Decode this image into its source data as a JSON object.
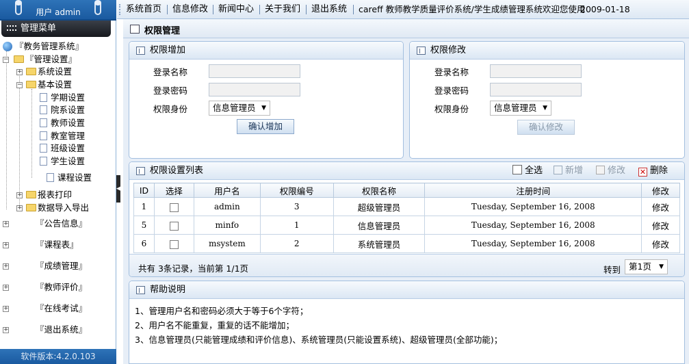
{
  "sidebar": {
    "user_label": "用户 admin",
    "menu_title": "管理菜单",
    "root": "『教务管理系统』",
    "tree": {
      "admin_setup": "『管理设置』",
      "system_setup": "系统设置",
      "basic_setup": "基本设置",
      "basic_children": [
        "学期设置",
        "院系设置",
        "教师设置",
        "教室管理",
        "班级设置",
        "学生设置"
      ],
      "course_setup": "课程设置",
      "report_print": "报表打印",
      "data_io": "数据导入导出"
    },
    "groups": [
      "『公告信息』",
      "『课程表』",
      "『成绩管理』",
      "『教师评价』",
      "『在线考试』",
      "『退出系统』"
    ],
    "version": "软件版本:4.2.0.103"
  },
  "topnav": {
    "items": [
      "系统首页",
      "信息修改",
      "新闻中心",
      "关于我们",
      "退出系统"
    ],
    "welcome": "careff 教师教学质量评价系统/学生成绩管理系统欢迎您使用",
    "date": "2009-01-18"
  },
  "page_title": "权限管理",
  "add_panel": {
    "title": "权限增加",
    "login_name_label": "登录名称",
    "login_pwd_label": "登录密码",
    "role_label": "权限身份",
    "role_value": "信息管理员",
    "submit": "确认增加"
  },
  "edit_panel": {
    "title": "权限修改",
    "login_name_label": "登录名称",
    "login_pwd_label": "登录密码",
    "role_label": "权限身份",
    "role_value": "信息管理员",
    "submit": "确认修改"
  },
  "list_panel": {
    "title": "权限设置列表",
    "select_all": "全选",
    "add": "新增",
    "edit": "修改",
    "delete": "删除",
    "columns": [
      "ID",
      "选择",
      "用户名",
      "权限编号",
      "权限名称",
      "注册时间",
      "修改"
    ],
    "rows": [
      {
        "id": "1",
        "username": "admin",
        "code": "3",
        "role": "超级管理员",
        "time": "Tuesday, September 16, 2008",
        "action": "修改"
      },
      {
        "id": "5",
        "username": "minfo",
        "code": "1",
        "role": "信息管理员",
        "time": "Tuesday, September 16, 2008",
        "action": "修改"
      },
      {
        "id": "6",
        "username": "msystem",
        "code": "2",
        "role": "系统管理员",
        "time": "Tuesday, September 16, 2008",
        "action": "修改"
      }
    ],
    "summary": "共有 3条记录，当前第 1/1页",
    "goto_label": "转到",
    "page_select": "第1页"
  },
  "help_panel": {
    "title": "帮助说明",
    "lines": [
      "1、管理用户名和密码必须大于等于6个字符；",
      "2、用户名不能重复，重复的话不能增加；",
      "3、信息管理员(只能管理成绩和评价信息)、系统管理员(只能设置系统)、超级管理员(全部功能)；"
    ]
  },
  "colors": {
    "accent": "#1a5aa0",
    "panel_border": "#a3bfdf",
    "main_bg": "#e7eef7"
  }
}
